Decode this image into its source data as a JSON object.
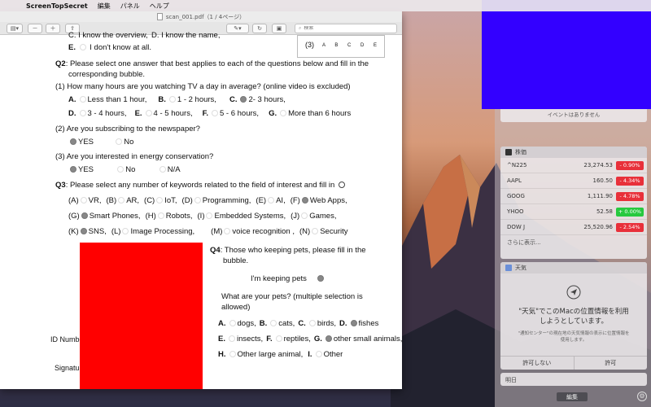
{
  "menubar": {
    "app": "ScreenTopSecret",
    "items": [
      "編集",
      "パネル",
      "ヘルプ"
    ]
  },
  "pdf": {
    "title": "scan_001.pdf（1 / 4ページ）",
    "search_placeholder": "検索"
  },
  "doc": {
    "top_frag1": "C. I know the overview,",
    "top_frag2": "D. I know the name,",
    "e_opt": "E.",
    "e_text": "I don't know at all.",
    "pager_num": "(3)",
    "pager_letters": "A B C D E",
    "q2_title": "Q2",
    "q2_text": ": Please select one answer that best applies to each of the questions below and fill in the",
    "q2_text2": "corresponding bubble.",
    "q2_1": "(1) How many hours are you watching TV a day in average? (online video is excluded)",
    "tv_row1": [
      {
        "l": "A.",
        "t": "Less than 1 hour,"
      },
      {
        "l": "B.",
        "t": "1 - 2 hours,"
      },
      {
        "l": "C.",
        "t": "2- 3 hours,"
      }
    ],
    "tv_row2": [
      {
        "l": "D.",
        "t": "3 - 4 hours,"
      },
      {
        "l": "E.",
        "t": "4 - 5 hours,"
      },
      {
        "l": "F.",
        "t": "5 - 6 hours,"
      },
      {
        "l": "G.",
        "t": "More than 6 hours"
      }
    ],
    "q2_2": "(2) Are you subscribing to the newspaper?",
    "news_yes": "YES",
    "news_no": "No",
    "q2_3": "(3) Are you interested in energy conservation?",
    "energy_yes": "YES",
    "energy_no": "No",
    "energy_na": "N/A",
    "q3_title": "Q3",
    "q3_text": ": Please select any number of keywords related to the field of interest and fill in",
    "kw_row1": [
      {
        "l": "(A)",
        "t": "VR,"
      },
      {
        "l": "(B)",
        "t": "AR,"
      },
      {
        "l": "(C)",
        "t": "IoT,"
      },
      {
        "l": "(D)",
        "t": "Programming,"
      },
      {
        "l": "(E)",
        "t": "AI,"
      },
      {
        "l": "(F)",
        "t": "Web Apps,"
      }
    ],
    "kw_row2": [
      {
        "l": "(G)",
        "t": "Smart Phones,"
      },
      {
        "l": "(H)",
        "t": "Robots,"
      },
      {
        "l": "(I)",
        "t": "Embedded Systems,"
      },
      {
        "l": "(J)",
        "t": "Games,"
      }
    ],
    "kw_row3": [
      {
        "l": "(K)",
        "t": "SNS,"
      },
      {
        "l": "(L)",
        "t": "Image Processing,"
      },
      {
        "l": "(M)",
        "t": "voice recognition ,"
      },
      {
        "l": "(N)",
        "t": "Security"
      }
    ],
    "q4_title": "Q4",
    "q4_text": ": Those who keeping pets, please fill in the",
    "q4_text2": "bubble.",
    "keeping": "I'm keeping pets",
    "pets_q": "What are your pets? (multiple selection is",
    "pets_q2": "allowed)",
    "pets_row1": [
      {
        "l": "A.",
        "t": "dogs,"
      },
      {
        "l": "B.",
        "t": "cats,"
      },
      {
        "l": "C.",
        "t": "birds,"
      },
      {
        "l": "D.",
        "t": "fishes"
      }
    ],
    "pets_row2": [
      {
        "l": "E.",
        "t": "insects,"
      },
      {
        "l": "F.",
        "t": "reptiles,"
      },
      {
        "l": "G.",
        "t": "other small animals,"
      }
    ],
    "pets_row3": [
      {
        "l": "H.",
        "t": "Other large animal,"
      },
      {
        "l": "I.",
        "t": "Other"
      }
    ],
    "id_label": "ID Numbe",
    "sig_label": "Signatur"
  },
  "nc": {
    "calendar_msg": "イベントはありません",
    "stocks_title": "株価",
    "stocks": [
      {
        "sym": "^N225",
        "price": "23,274.53",
        "chg": "- 0.90%",
        "dir": "neg"
      },
      {
        "sym": "AAPL",
        "price": "160.50",
        "chg": "- 4.34%",
        "dir": "neg"
      },
      {
        "sym": "GOOG",
        "price": "1,111.90",
        "chg": "- 4.78%",
        "dir": "neg"
      },
      {
        "sym": "YHOO",
        "price": "52.58",
        "chg": "+ 0.00%",
        "dir": "pos"
      },
      {
        "sym": "DOW J",
        "price": "25,520.96",
        "chg": "- 2.54%",
        "dir": "neg"
      }
    ],
    "stocks_more": "さらに表示...",
    "weather_title": "天気",
    "weather_msg1": "\"天気\"でこのMacの位置情報を利用",
    "weather_msg2": "しようとしています。",
    "weather_sub1": "\"通知センター\"の現在地の天気情報の表示に位置情報を",
    "weather_sub2": "使用します。",
    "deny": "許可しない",
    "allow": "許可",
    "tomorrow": "明日",
    "edit": "編集"
  },
  "colors": {
    "red_box": "#ff0000",
    "blue_box": "#3300ff",
    "stock_down": "#e8303a",
    "stock_up": "#27c93f"
  }
}
